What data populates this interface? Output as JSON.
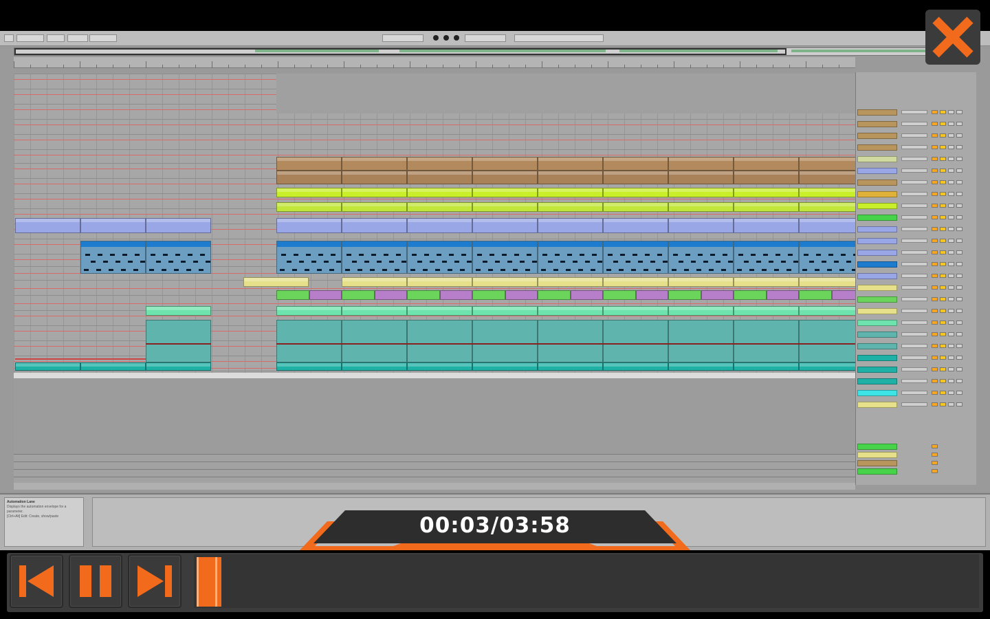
{
  "player": {
    "time_display": "00:03/03:58",
    "progress": 0.013,
    "accent_color": "#f26a1b",
    "close_icon": "close-x-icon",
    "buttons": {
      "previous": "skip-previous-icon",
      "pause": "pause-icon",
      "next": "skip-next-icon"
    }
  },
  "daw": {
    "info_panel": {
      "title": "Automation Lane",
      "line1": "Displays the automation envelope for a",
      "line2": "parameter.",
      "line3": "[Ctrl+Alt] Edit: Create, show/paste"
    }
  }
}
